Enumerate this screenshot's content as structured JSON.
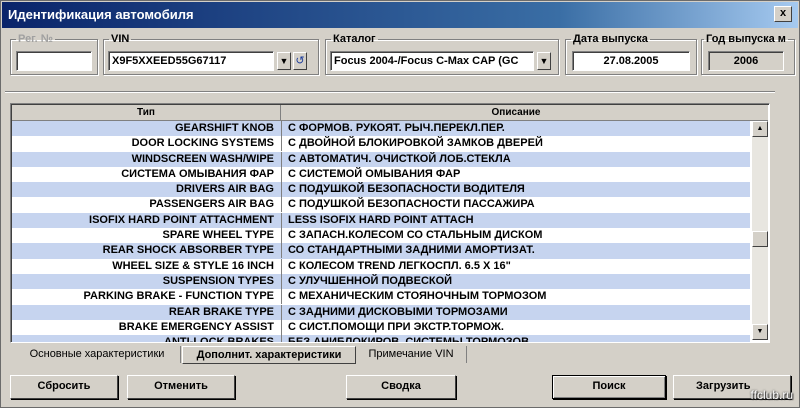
{
  "window": {
    "title": "Идентификация автомобиля",
    "close_label": "x"
  },
  "fields": {
    "reg_no": {
      "label": "Рег. №",
      "value": ""
    },
    "vin": {
      "label": "VIN",
      "value": "X9F5XXEED55G67117"
    },
    "catalog": {
      "label": "Каталог",
      "value": "Focus 2004-/Focus C-Max CAP (GC"
    },
    "release_date": {
      "label": "Дата выпуска",
      "value": "27.08.2005"
    },
    "release_year": {
      "label": "Год выпуска м",
      "value": "2006"
    }
  },
  "grid": {
    "columns": [
      "Тип",
      "Описание"
    ],
    "rows": [
      {
        "type": "GEARSHIFT KNOB",
        "desc": "С ФОРМОВ. РУКОЯТ. РЫЧ.ПЕРЕКЛ.ПЕР."
      },
      {
        "type": "DOOR LOCKING SYSTEMS",
        "desc": "С ДВОЙНОЙ БЛОКИРОВКОЙ ЗАМКОВ ДВЕРЕЙ"
      },
      {
        "type": "WINDSCREEN WASH/WIPE",
        "desc": "С АВТОМАТИЧ. ОЧИСТКОЙ ЛОБ.СТЕКЛА"
      },
      {
        "type": "СИСТЕМА ОМЫВАНИЯ ФАР",
        "desc": "С СИСТЕМОЙ ОМЫВАНИЯ ФАР"
      },
      {
        "type": "DRIVERS AIR BAG",
        "desc": "С ПОДУШКОЙ БЕЗОПАСНОСТИ ВОДИТЕЛЯ"
      },
      {
        "type": "PASSENGERS AIR BAG",
        "desc": "С ПОДУШКОЙ БЕЗОПАСНОСТИ ПАССАЖИРА"
      },
      {
        "type": "ISOFIX HARD POINT ATTACHMENT",
        "desc": "LESS ISOFIX HARD POINT ATTACH"
      },
      {
        "type": "SPARE WHEEL TYPE",
        "desc": "С ЗАПАСН.КОЛЕСОМ СО СТАЛЬНЫМ ДИСКОМ"
      },
      {
        "type": "REAR SHOCK ABSORBER TYPE",
        "desc": "СО СТАНДАРТНЫМИ ЗАДНИМИ АМОРТИЗАТ."
      },
      {
        "type": "WHEEL SIZE & STYLE 16 INCH",
        "desc": "С КОЛЕСОМ TREND ЛЕГКОСПЛ. 6.5 X 16\""
      },
      {
        "type": "SUSPENSION TYPES",
        "desc": "С УЛУЧШЕННОЙ ПОДВЕСКОЙ"
      },
      {
        "type": "PARKING BRAKE - FUNCTION TYPE",
        "desc": "С МЕХАНИЧЕСКИМ СТОЯНОЧНЫМ ТОРМОЗОМ"
      },
      {
        "type": "REAR BRAKE TYPE",
        "desc": "С ЗАДНИМИ ДИСКОВЫМИ ТОРМОЗАМИ"
      },
      {
        "type": "BRAKE EMERGENCY ASSIST",
        "desc": "С СИСТ.ПОМОЩИ ПРИ ЭКСТР.ТОРМОЖ."
      },
      {
        "type": "ANTI-LOCK BRAKES",
        "desc": "БЕЗ АНИБЛОКИРОВ. СИСТЕМЫ ТОРМОЗОВ"
      }
    ]
  },
  "tabs": [
    {
      "label": "Основные характеристики"
    },
    {
      "label": "Дополнит. характеристики"
    },
    {
      "label": "Примечание VIN"
    }
  ],
  "buttons": {
    "reset": "Сбросить",
    "cancel": "Отменить",
    "summary": "Сводка",
    "search": "Поиск",
    "load": "Загрузить"
  },
  "watermark": "ffclub.ru"
}
